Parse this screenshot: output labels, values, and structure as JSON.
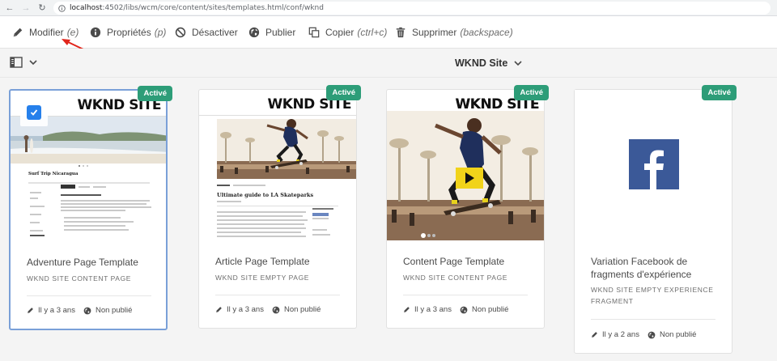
{
  "browser": {
    "url_host": "localhost",
    "url_path": ":4502/libs/wcm/core/content/sites/templates.html/conf/wknd"
  },
  "toolbar": {
    "modify_label": "Modifier",
    "modify_hint": "(e)",
    "properties_label": "Propriétés",
    "properties_hint": "(p)",
    "disable_label": "Désactiver",
    "publish_label": "Publier",
    "copy_label": "Copier",
    "copy_hint": "(ctrl+c)",
    "delete_label": "Supprimer",
    "delete_hint": "(backspace)"
  },
  "header": {
    "site_title": "WKND Site"
  },
  "cards": [
    {
      "badge": "Activé",
      "title": "Adventure Page Template",
      "subtitle": "WKND SITE CONTENT PAGE",
      "modified": "Il y a 3 ans",
      "status": "Non publié",
      "thumb_brand": "WKND SITE",
      "thumb_heading": "Surf Trip Nicaragua"
    },
    {
      "badge": "Activé",
      "title": "Article Page Template",
      "subtitle": "WKND SITE EMPTY PAGE",
      "modified": "Il y a 3 ans",
      "status": "Non publié",
      "thumb_brand": "WKND SITE",
      "thumb_heading": "Ultimate guide to LA Skateparks"
    },
    {
      "badge": "Activé",
      "title": "Content Page Template",
      "subtitle": "WKND SITE CONTENT PAGE",
      "modified": "Il y a 3 ans",
      "status": "Non publié",
      "thumb_brand": "WKND SITE"
    },
    {
      "badge": "Activé",
      "title": "Variation Facebook de fragments d'expérience",
      "subtitle": "WKND SITE EMPTY EXPERIENCE FRAGMENT",
      "modified": "Il y a 2 ans",
      "status": "Non publié"
    }
  ],
  "colors": {
    "badge": "#2d9d78",
    "selection": "#2680eb",
    "annotation": "#e1251b",
    "facebook": "#3b5998"
  },
  "icons": {
    "modify": "pencil-icon",
    "properties": "info-icon",
    "disable": "ban-icon",
    "publish": "globe-icon",
    "copy": "copy-icon",
    "delete": "trash-icon"
  }
}
